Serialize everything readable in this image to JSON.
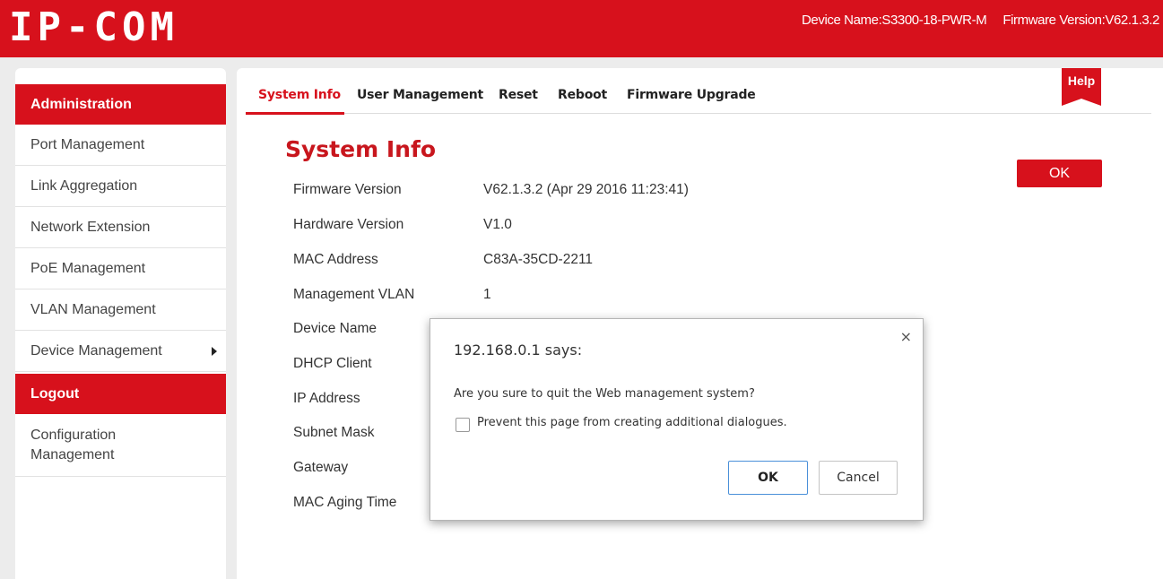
{
  "brand": {
    "logo": "IP-COM"
  },
  "header": {
    "device_name": "Device Name:S3300-18-PWR-M",
    "firmware_version": "Firmware Version:V62.1.3.2"
  },
  "sidebar": {
    "section_admin": "Administration",
    "items": [
      {
        "label": "Port Management"
      },
      {
        "label": "Link Aggregation"
      },
      {
        "label": "Network Extension"
      },
      {
        "label": "PoE Management"
      },
      {
        "label": "VLAN Management"
      },
      {
        "label": "Device Management"
      }
    ],
    "logout": "Logout",
    "config_line1": "Configuration",
    "config_line2": "Management"
  },
  "tabs": [
    {
      "label": "System Info",
      "active": true
    },
    {
      "label": "User Management"
    },
    {
      "label": "Reset"
    },
    {
      "label": "Reboot"
    },
    {
      "label": "Firmware Upgrade"
    }
  ],
  "help_label": "Help",
  "page": {
    "title": "System Info",
    "ok_label": "OK",
    "rows": [
      {
        "label": "Firmware Version",
        "value": "V62.1.3.2 (Apr 29 2016 11:23:41)"
      },
      {
        "label": "Hardware Version",
        "value": "V1.0"
      },
      {
        "label": "MAC Address",
        "value": "C83A-35CD-2211"
      },
      {
        "label": "Management VLAN",
        "value": "1"
      },
      {
        "label": "Device Name"
      },
      {
        "label": "DHCP Client"
      },
      {
        "label": "IP Address"
      },
      {
        "label": "Subnet Mask"
      },
      {
        "label": "Gateway"
      },
      {
        "label": "MAC Aging Time"
      }
    ]
  },
  "dialog": {
    "title": "192.168.0.1 says:",
    "close": "×",
    "message": "Are you sure to quit the Web management system?",
    "checkbox_label": "Prevent this page from creating additional dialogues.",
    "ok": "OK",
    "cancel": "Cancel"
  },
  "colors": {
    "accent": "#d7111c",
    "dialog_ok_border": "#4a90d9"
  }
}
